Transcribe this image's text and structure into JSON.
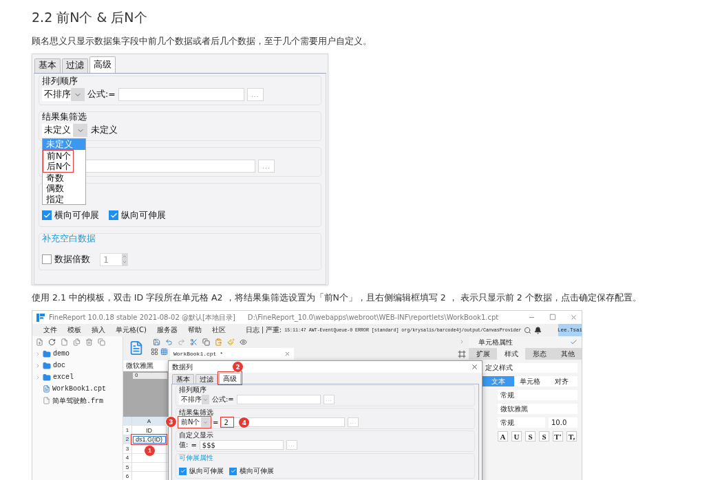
{
  "heading": "2.2 前N个 & 后N个",
  "intro": "顾名思义只显示数据集字段中前几个数据或者后几个数据，至于几个需要用户自定义。",
  "figure_1": {
    "tabs": [
      {
        "label": "基本",
        "selected": false
      },
      {
        "label": "过滤",
        "selected": false
      },
      {
        "label": "高级",
        "selected": true
      }
    ],
    "sort": {
      "title": "排列顺序",
      "select": "不排序",
      "formula_label": "公式:=",
      "more": "..."
    },
    "filter": {
      "title": "结果集筛选",
      "select": "未定义",
      "value_label": "未定义",
      "options": [
        {
          "label": "未定义",
          "selected": true,
          "highlighted": false
        },
        {
          "label": "前N个",
          "selected": false,
          "highlighted": true
        },
        {
          "label": "后N个",
          "selected": false,
          "highlighted": true
        },
        {
          "label": "奇数",
          "selected": false,
          "highlighted": false
        },
        {
          "label": "偶数",
          "selected": false,
          "highlighted": false
        },
        {
          "label": "指定",
          "selected": false,
          "highlighted": false
        }
      ]
    },
    "custom": {
      "more": "..."
    },
    "expand": {
      "checks": [
        {
          "label": "横向可伸展",
          "checked": true
        },
        {
          "label": "纵向可伸展",
          "checked": true
        }
      ]
    },
    "fill": {
      "title": "补充空白数据",
      "check": {
        "label": "数据倍数",
        "checked": false
      },
      "value": "1"
    }
  },
  "instruction": "使用 2.1 中的模板，双击 ID 字段所在单元格 A2 ，将结果集筛选设置为「前N个」，且右侧编辑框填写 2 ， 表示只显示前 2 个数据，点击确定保存配置。",
  "figure_2": {
    "title": "FineReport 10.0.18 stable 2021-08-02 @默认[本地目录]",
    "path": "D:\\FineReport_10.0\\webapps\\webroot\\WEB-INF\\reportlets\\WorkBook1.cpt",
    "menu": [
      "文件",
      "模板",
      "插入",
      "单元格(C)",
      "服务器",
      "帮助",
      "社区"
    ],
    "log_label": "日志",
    "log_level": "严重:",
    "log_message": "15:11:47 AWT-EventQueue-0 ERROR [standard] org/krysalis/barcode4j/output/CanvasProvider",
    "user": "Lee.Tsai",
    "tree": [
      {
        "label": "demo",
        "kind": "folder"
      },
      {
        "label": "doc",
        "kind": "folder"
      },
      {
        "label": "excel",
        "kind": "folder"
      },
      {
        "label": "WorkBook1.cpt",
        "kind": "report"
      },
      {
        "label": "简单驾驶舱.frm",
        "kind": "form"
      }
    ],
    "doc_tab": "WorkBook1.cpt *",
    "font_select": "微软雅黑",
    "ruler": "0",
    "grid": {
      "column": "A",
      "rows": [
        {
          "number": "1",
          "value": "ID",
          "selected": false
        },
        {
          "number": "2",
          "value": "ds1.G(ID)",
          "selected": true,
          "badge": "1"
        },
        {
          "number": "3",
          "selected": false
        },
        {
          "number": "4",
          "selected": false
        },
        {
          "number": "5",
          "selected": false
        },
        {
          "number": "6",
          "selected": false
        }
      ]
    },
    "dialog": {
      "title": "数据列",
      "tabs": [
        {
          "label": "基本",
          "selected": false
        },
        {
          "label": "过滤",
          "selected": false
        },
        {
          "label": "高级",
          "selected": true,
          "badge": "2"
        }
      ],
      "sort": {
        "title": "排列顺序",
        "select": "不排序",
        "formula_label": "公式:=",
        "more": "..."
      },
      "filter": {
        "title": "结果集筛选",
        "select": "前N个",
        "select_badge": "3",
        "equals": "=",
        "value": "2",
        "value_badge": "4",
        "more": "..."
      },
      "custom": {
        "title": "自定义显示",
        "label": "值:",
        "equals": "=",
        "value": "$$$",
        "more": "..."
      },
      "expand": {
        "title": "可伸展属性",
        "checks": [
          {
            "label": "纵向可伸展",
            "checked": true
          },
          {
            "label": "横向可伸展",
            "checked": true
          }
        ]
      }
    },
    "properties": {
      "title": "单元格属性",
      "tabs": [
        {
          "label": "扩展",
          "selected": false
        },
        {
          "label": "样式",
          "selected": true
        },
        {
          "label": "形态",
          "selected": false
        },
        {
          "label": "其他",
          "selected": false
        }
      ],
      "style_select": "定义样式",
      "subtabs": [
        {
          "label": "文本",
          "selected": true
        },
        {
          "label": "单元格",
          "selected": false
        },
        {
          "label": "对齐",
          "selected": false
        }
      ],
      "format_select": "常规",
      "font_select": "微软雅黑",
      "font_style": "常规",
      "font_size": "10.0",
      "format_buttons": [
        "A",
        "U",
        "S",
        "S",
        "T'",
        "T,"
      ]
    }
  }
}
